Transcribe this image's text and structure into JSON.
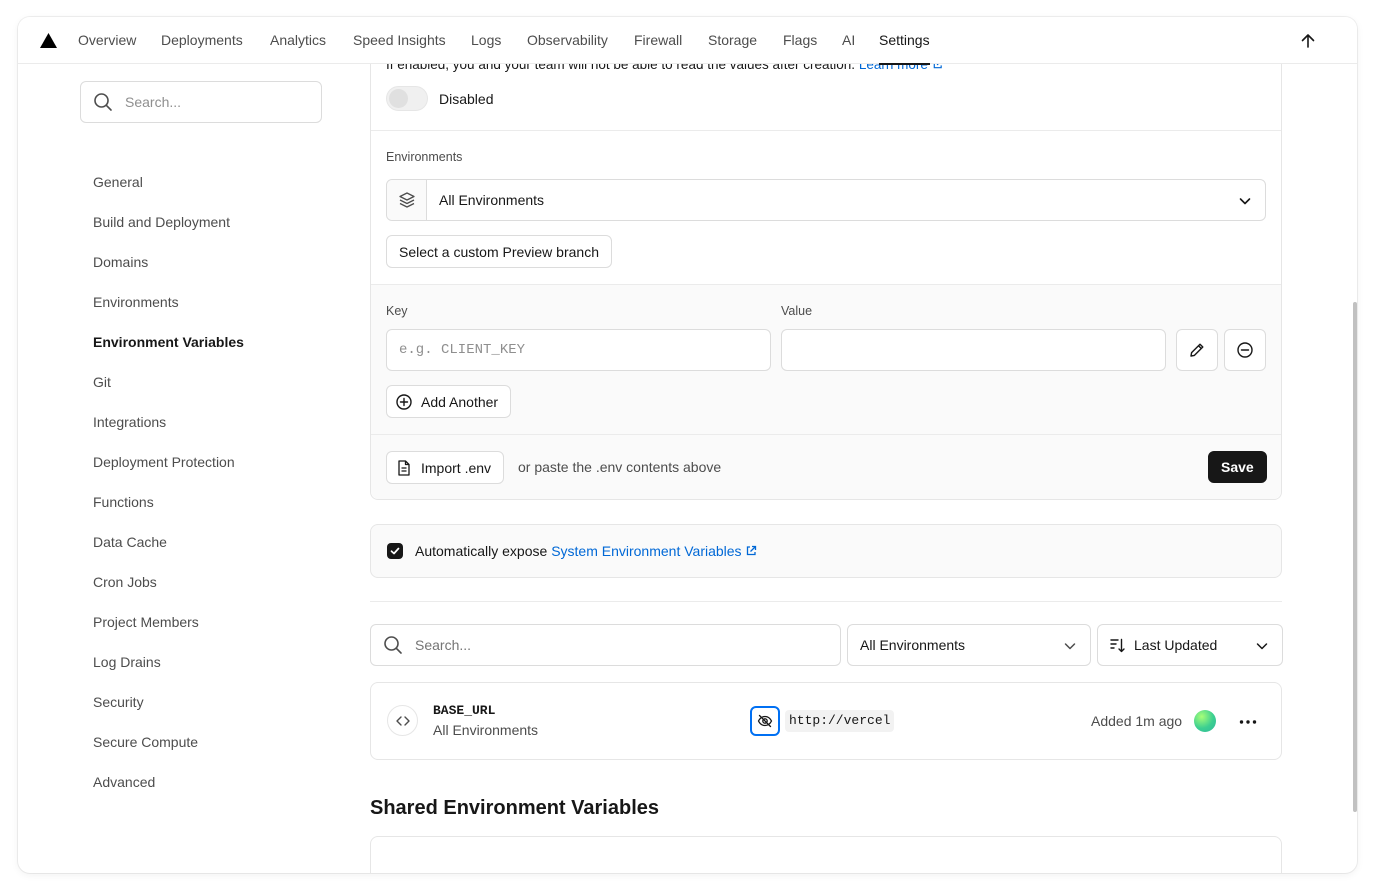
{
  "nav": {
    "tabs": [
      "Overview",
      "Deployments",
      "Analytics",
      "Speed Insights",
      "Logs",
      "Observability",
      "Firewall",
      "Storage",
      "Flags",
      "AI",
      "Settings"
    ],
    "active_tab": "Settings"
  },
  "sidebar": {
    "search_placeholder": "Search...",
    "items": [
      "General",
      "Build and Deployment",
      "Domains",
      "Environments",
      "Environment Variables",
      "Git",
      "Integrations",
      "Deployment Protection",
      "Functions",
      "Data Cache",
      "Cron Jobs",
      "Project Members",
      "Log Drains",
      "Security",
      "Secure Compute",
      "Advanced"
    ],
    "active_item": "Environment Variables"
  },
  "form": {
    "sensitive_text": "If enabled, you and your team will not be able to read the values after creation.",
    "learn_more": "Learn more",
    "sensitive_toggle_state": "Disabled",
    "environments_label": "Environments",
    "environments_value": "All Environments",
    "preview_branch_button": "Select a custom Preview branch",
    "key_label": "Key",
    "value_label": "Value",
    "key_placeholder": "e.g. CLIENT_KEY",
    "value_value": "",
    "add_another": "Add Another",
    "import_env": "Import .env",
    "paste_hint": "or paste the .env contents above",
    "save": "Save"
  },
  "expose": {
    "checked": true,
    "text": "Automatically expose",
    "link": "System Environment Variables"
  },
  "filters": {
    "search_placeholder": "Search...",
    "environment": "All Environments",
    "sort": "Last Updated"
  },
  "variables": [
    {
      "name": "BASE_URL",
      "environments": "All Environments",
      "value": "http://vercel",
      "added": "Added 1m ago"
    }
  ],
  "shared": {
    "title": "Shared Environment Variables"
  },
  "colors": {
    "link": "#0068d6",
    "primary_button": "#171717",
    "focus_ring": "#0070f3"
  }
}
